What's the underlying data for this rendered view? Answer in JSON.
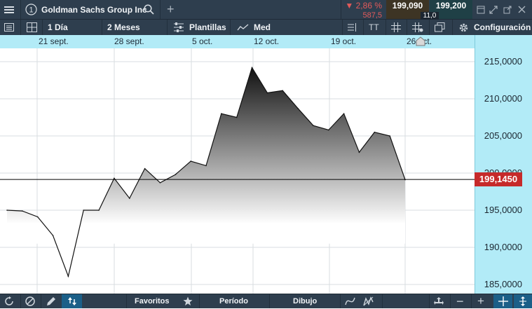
{
  "header": {
    "instrument": "Goldman Sachs Group Inc",
    "change_pct": "▼ 2,86 %",
    "change_abs": "587,5",
    "bid": "199,090",
    "spread": "11,0",
    "ask": "199,200",
    "colors": {
      "bid_bg": "#3d3424",
      "ask_bg": "#1f4046",
      "down": "#e35a5a"
    }
  },
  "toolbar": {
    "interval": "1 Día",
    "period": "2 Meses",
    "templates": "Plantillas",
    "chart_type": "Med",
    "text_tool": "TT",
    "settings": "Configuración"
  },
  "bottombar": {
    "favorites": "Favoritos",
    "period": "Período",
    "drawing": "Dibujo"
  },
  "chart_data": {
    "type": "area",
    "x_labels": [
      "21 sept.",
      "28 sept.",
      "5 oct.",
      "12 oct.",
      "19 oct.",
      "26 oct."
    ],
    "y_ticks": [
      "215,0000",
      "210,0000",
      "205,0000",
      "200,0000",
      "195,0000",
      "190,0000",
      "185,0000"
    ],
    "ylim": [
      184,
      217
    ],
    "current_price_label": "199,1450",
    "current_price": 199.145,
    "series": [
      {
        "values": [
          [
            1,
            195.0
          ],
          [
            2,
            194.9
          ],
          [
            3,
            194.1
          ],
          [
            4,
            191.6
          ],
          [
            5,
            186.1
          ],
          [
            6,
            195.0
          ],
          [
            7,
            195.0
          ],
          [
            8,
            199.3
          ],
          [
            9,
            196.6
          ],
          [
            10,
            200.6
          ],
          [
            11,
            198.7
          ],
          [
            12,
            199.8
          ],
          [
            13,
            201.6
          ],
          [
            14,
            201.0
          ],
          [
            15,
            208.0
          ],
          [
            16,
            207.5
          ],
          [
            17,
            214.2
          ],
          [
            18,
            210.8
          ],
          [
            19,
            211.1
          ],
          [
            20,
            208.7
          ],
          [
            21,
            206.4
          ],
          [
            22,
            205.8
          ],
          [
            23,
            208.0
          ],
          [
            24,
            202.8
          ],
          [
            25,
            205.5
          ],
          [
            26,
            205.0
          ],
          [
            27,
            199.1
          ]
        ]
      }
    ],
    "grid": true,
    "colors": {
      "area_top": "#111111",
      "area_bottom": "#ffffff",
      "line": "#111111",
      "price_line": "#000000",
      "axis_bg": "#b2ebf7"
    }
  }
}
